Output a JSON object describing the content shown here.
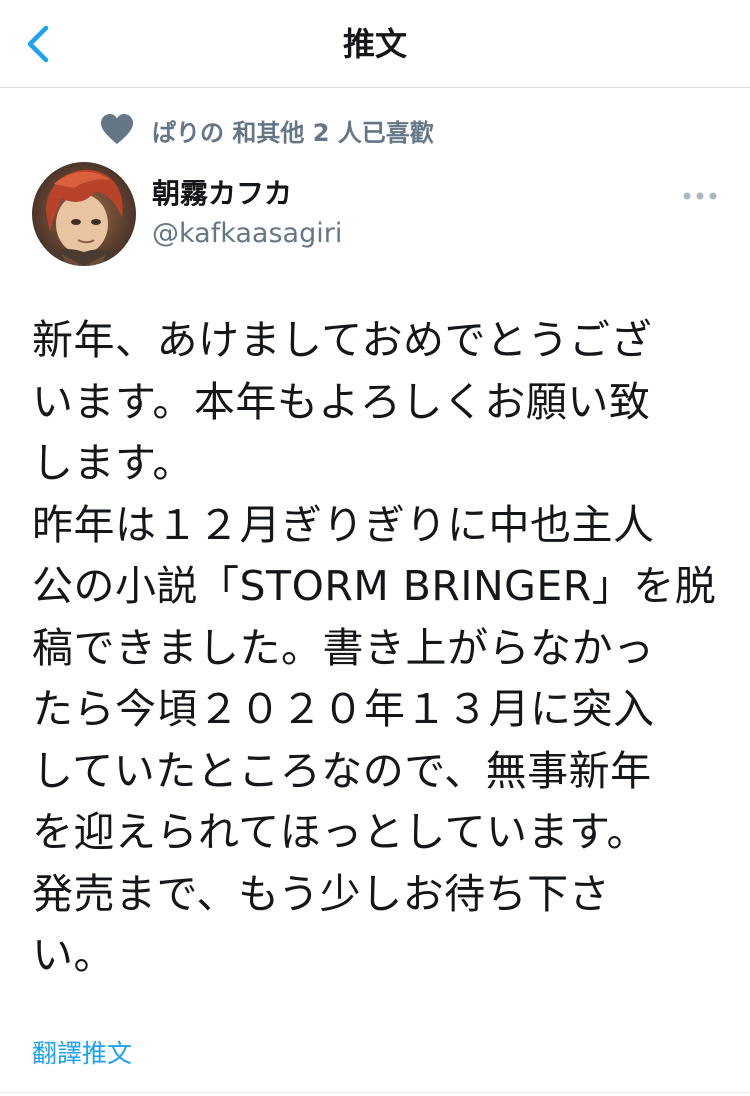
{
  "header": {
    "title": "推文",
    "back_icon": "chevron-left-icon"
  },
  "social_context": {
    "icon": "heart-icon",
    "text": "ぱりの 和其他 2 人已喜歡"
  },
  "author": {
    "display_name": "朝霧カフカ",
    "handle": "@kafkaasagiri",
    "avatar": "avatar"
  },
  "tweet": {
    "lines": [
      "新年、あけましておめでとうござ",
      "います。本年もよろしくお願い致",
      "します。",
      "昨年は１２月ぎりぎりに中也主人",
      "公の小説「STORM BRINGER」を脱",
      "稿できました。書き上がらなかっ",
      "たら今頃２０２０年１３月に突入",
      "していたところなので、無事新年",
      "を迎えられてほっとしています。",
      "発売まで、もう少しお待ち下さ",
      "い。"
    ]
  },
  "translate_label": "翻譯推文",
  "colors": {
    "accent": "#1da1f2",
    "secondary_text": "#657786",
    "primary_text": "#14171a",
    "heart": "#657786"
  }
}
